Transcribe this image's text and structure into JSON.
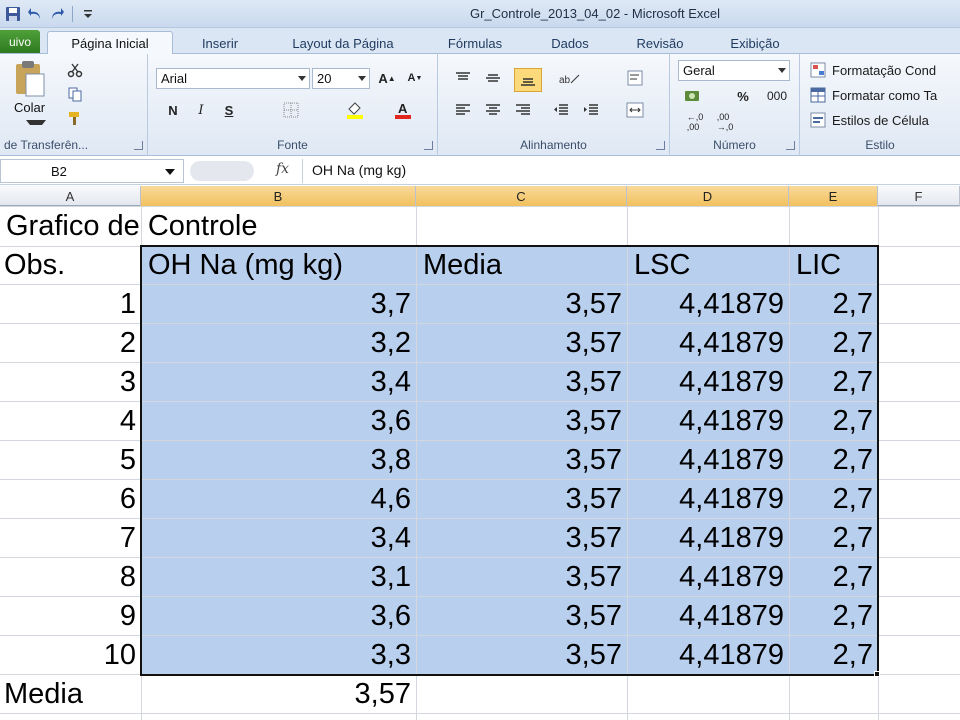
{
  "window": {
    "title": "Gr_Controle_2013_04_02  -  Microsoft Excel"
  },
  "quick_access": {
    "icons": [
      "save-icon",
      "undo-icon",
      "redo-icon",
      "customize-icon"
    ]
  },
  "ribbon": {
    "tabs": {
      "file": "uivo",
      "home": "Página Inicial",
      "insert": "Inserir",
      "page_layout": "Layout da Página",
      "formulas": "Fórmulas",
      "data": "Dados",
      "review": "Revisão",
      "view": "Exibição"
    },
    "clipboard": {
      "paste_label": "Colar",
      "group_label": "de Transferên..."
    },
    "font": {
      "name": "Arial",
      "size": "20",
      "bold": "N",
      "italic": "I",
      "underline": "S",
      "group_label": "Fonte",
      "fill_color": "#ffff00",
      "font_color": "#e0261f"
    },
    "alignment": {
      "group_label": "Alinhamento"
    },
    "number": {
      "format": "Geral",
      "percent": "%",
      "thousands": "000",
      "group_label": "Número"
    },
    "styles": {
      "conditional": "Formatação Cond",
      "format_table": "Formatar como Ta",
      "cell_styles": "Estilos de Célula",
      "group_label": "Estilo"
    }
  },
  "formula_bar": {
    "cell_ref": "B2",
    "fx": "fx",
    "value": "OH Na (mg kg)"
  },
  "columns": [
    "A",
    "B",
    "C",
    "D",
    "E",
    "F"
  ],
  "sheet": {
    "title": "Grafico de Controle",
    "headers": {
      "obs": "Obs.",
      "oh_na": "OH Na (mg kg)",
      "media": "Media",
      "lsc": "LSC",
      "lic": "LIC"
    },
    "rows": [
      {
        "obs": "1",
        "oh_na": "3,7",
        "media": "3,57",
        "lsc": "4,41879",
        "lic": "2,7"
      },
      {
        "obs": "2",
        "oh_na": "3,2",
        "media": "3,57",
        "lsc": "4,41879",
        "lic": "2,7"
      },
      {
        "obs": "3",
        "oh_na": "3,4",
        "media": "3,57",
        "lsc": "4,41879",
        "lic": "2,7"
      },
      {
        "obs": "4",
        "oh_na": "3,6",
        "media": "3,57",
        "lsc": "4,41879",
        "lic": "2,7"
      },
      {
        "obs": "5",
        "oh_na": "3,8",
        "media": "3,57",
        "lsc": "4,41879",
        "lic": "2,7"
      },
      {
        "obs": "6",
        "oh_na": "4,6",
        "media": "3,57",
        "lsc": "4,41879",
        "lic": "2,7"
      },
      {
        "obs": "7",
        "oh_na": "3,4",
        "media": "3,57",
        "lsc": "4,41879",
        "lic": "2,7"
      },
      {
        "obs": "8",
        "oh_na": "3,1",
        "media": "3,57",
        "lsc": "4,41879",
        "lic": "2,7"
      },
      {
        "obs": "9",
        "oh_na": "3,6",
        "media": "3,57",
        "lsc": "4,41879",
        "lic": "2,7"
      },
      {
        "obs": "10",
        "oh_na": "3,3",
        "media": "3,57",
        "lsc": "4,41879",
        "lic": "2,7"
      }
    ],
    "footer": {
      "label": "Media",
      "value": "3,57"
    }
  },
  "colors": {
    "selection_fill": "#b8cfee",
    "selected_header": "#f1c15f",
    "file_tab": "#2d7a1f"
  }
}
